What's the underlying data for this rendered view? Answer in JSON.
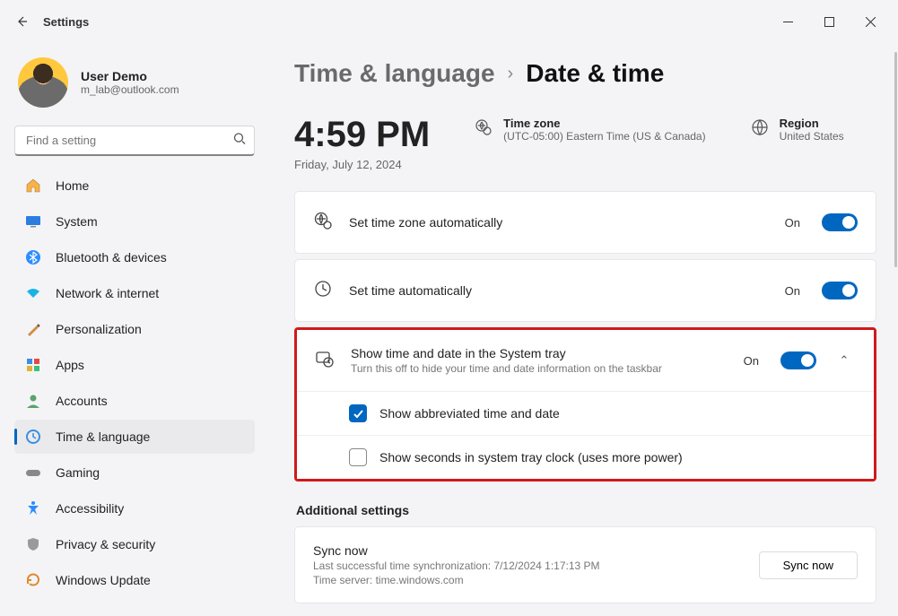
{
  "window": {
    "title": "Settings"
  },
  "user": {
    "name": "User Demo",
    "email": "m_lab@outlook.com"
  },
  "search": {
    "placeholder": "Find a setting"
  },
  "nav": {
    "items": [
      {
        "label": "Home"
      },
      {
        "label": "System"
      },
      {
        "label": "Bluetooth & devices"
      },
      {
        "label": "Network & internet"
      },
      {
        "label": "Personalization"
      },
      {
        "label": "Apps"
      },
      {
        "label": "Accounts"
      },
      {
        "label": "Time & language"
      },
      {
        "label": "Gaming"
      },
      {
        "label": "Accessibility"
      },
      {
        "label": "Privacy & security"
      },
      {
        "label": "Windows Update"
      }
    ]
  },
  "breadcrumb": {
    "parent": "Time & language",
    "current": "Date & time"
  },
  "clock": {
    "time": "4:59 PM",
    "date": "Friday, July 12, 2024",
    "tz_label": "Time zone",
    "tz_value": "(UTC-05:00) Eastern Time (US & Canada)",
    "region_label": "Region",
    "region_value": "United States"
  },
  "settings": {
    "auto_tz": {
      "title": "Set time zone automatically",
      "state": "On"
    },
    "auto_time": {
      "title": "Set time automatically",
      "state": "On"
    },
    "tray": {
      "title": "Show time and date in the System tray",
      "subtitle": "Turn this off to hide your time and date information on the taskbar",
      "state": "On",
      "opt1": "Show abbreviated time and date",
      "opt2": "Show seconds in system tray clock (uses more power)"
    }
  },
  "additional": {
    "heading": "Additional settings",
    "sync_title": "Sync now",
    "sync_last": "Last successful time synchronization: 7/12/2024 1:17:13 PM",
    "sync_server": "Time server: time.windows.com",
    "sync_button": "Sync now"
  }
}
